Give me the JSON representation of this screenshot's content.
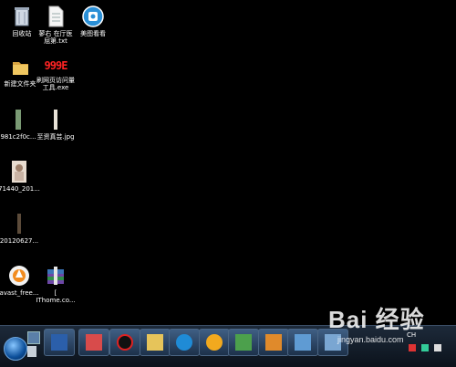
{
  "desktop": {
    "icons": [
      {
        "label": "回收站"
      },
      {
        "label": "蓼右 在厅医",
        "label2": "屈第.txt"
      },
      {
        "label": "美图看看"
      },
      {
        "label": "新建文件夹"
      },
      {
        "label": "刷网页访问量",
        "label2": "工具.exe",
        "art_text": "999E"
      },
      {
        "label": "981c2f0c..."
      },
      {
        "label": "至资真芸.jpg"
      },
      {
        "label": "71440_201..."
      },
      {
        "label": "20120627..."
      },
      {
        "label": "avast_free..."
      },
      {
        "label": "[",
        "label2": "IThome.co..."
      }
    ]
  },
  "taskbar": {
    "buttons": [
      "app-1",
      "app-2",
      "app-3",
      "app-4",
      "app-5",
      "app-6",
      "app-7",
      "app-8",
      "app-9",
      "app-10"
    ]
  },
  "tray": {
    "lang": "CH"
  },
  "watermark": {
    "brand": "Bai 经验",
    "url": "jingyan.baidu.com"
  }
}
